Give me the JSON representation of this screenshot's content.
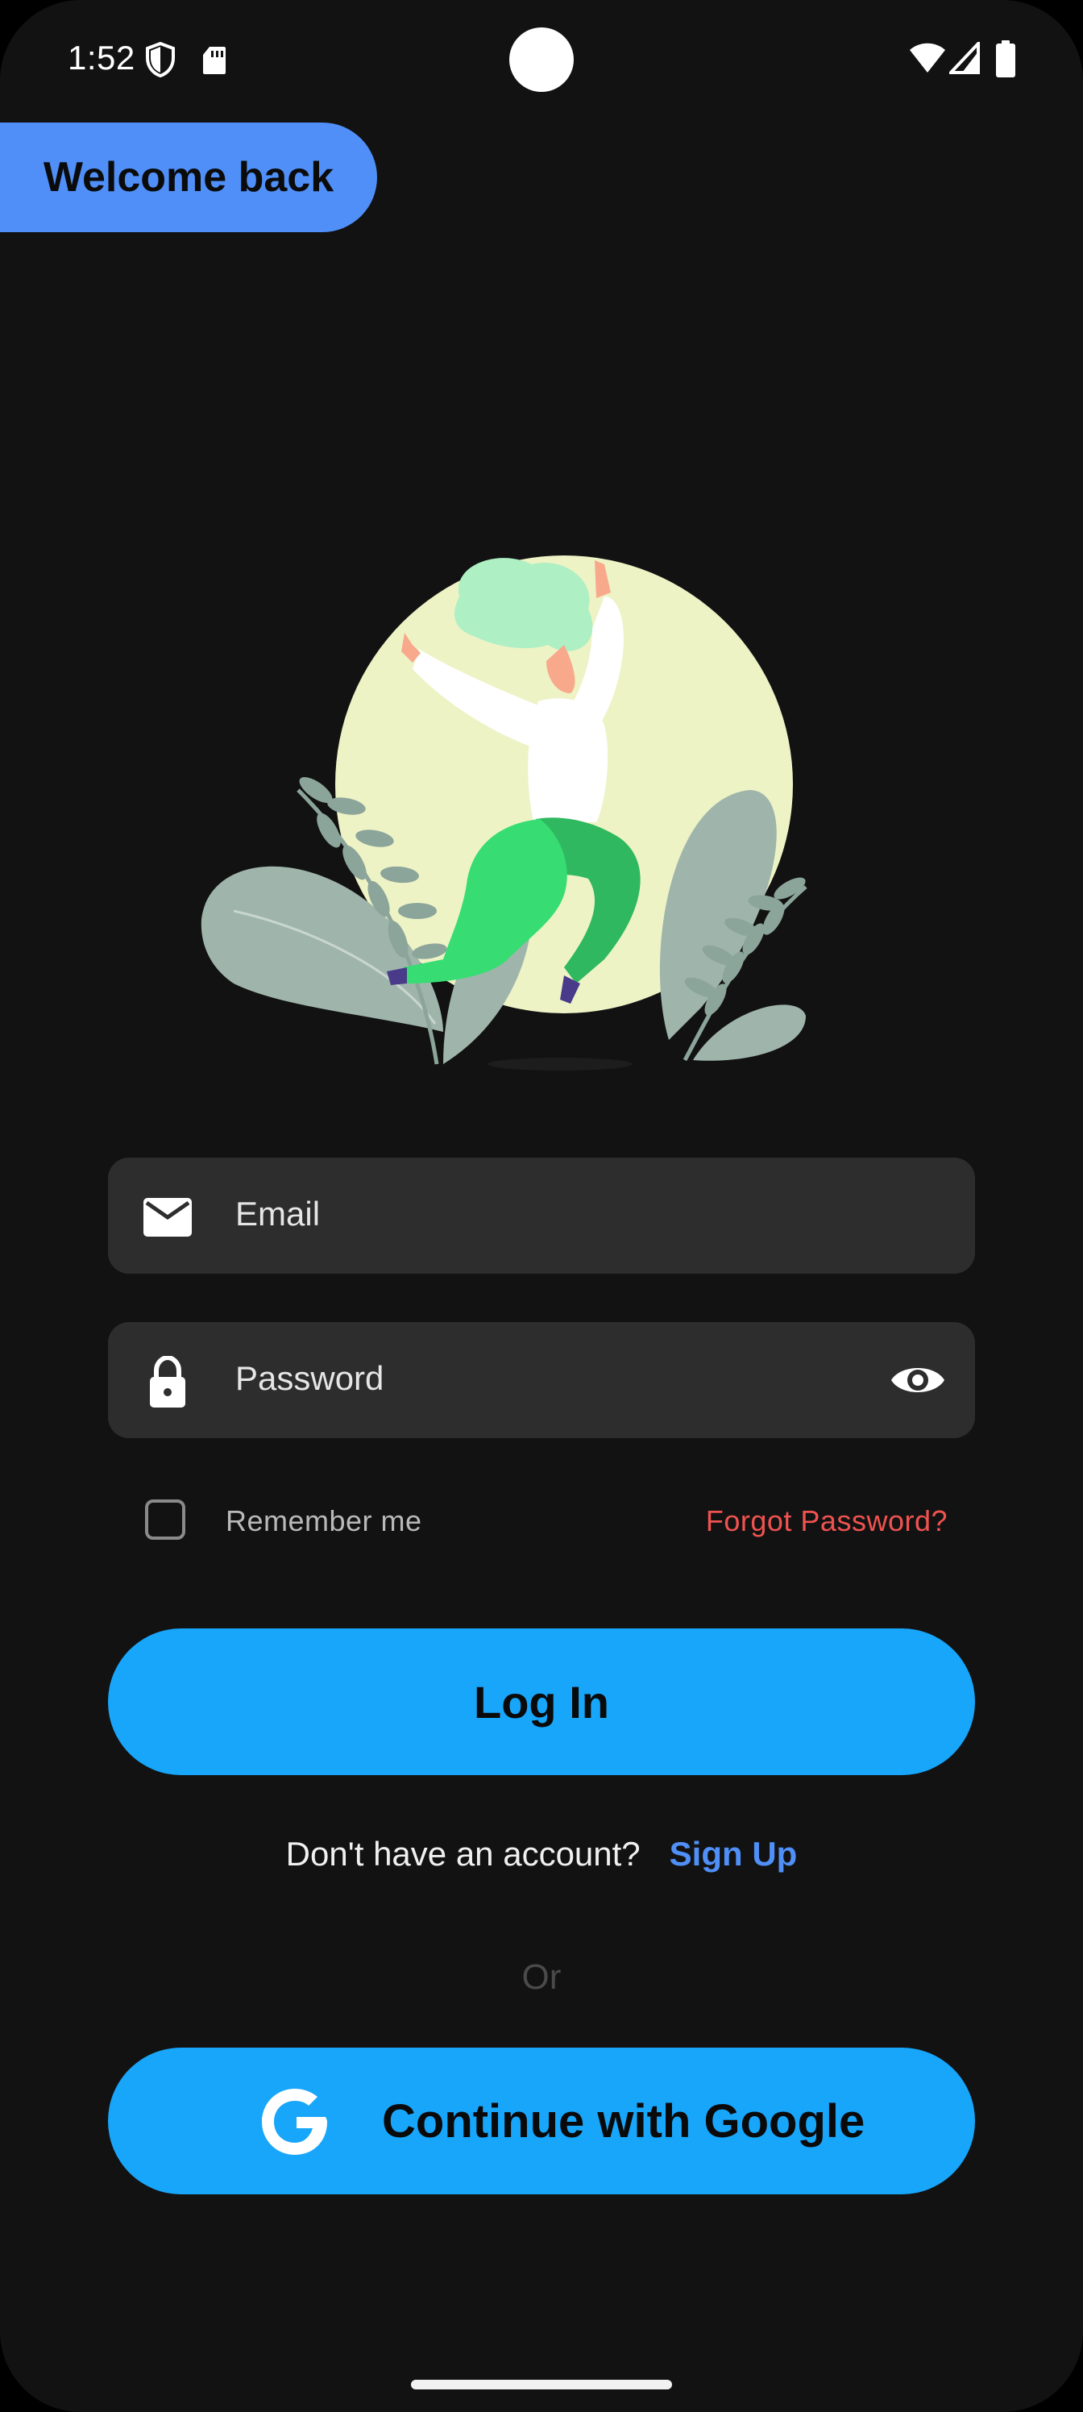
{
  "status_bar": {
    "time": "1:52",
    "icons_left": [
      "shield-icon",
      "sd-card-icon"
    ],
    "icons_right": [
      "wifi-icon",
      "signal-icon",
      "battery-icon"
    ]
  },
  "header": {
    "welcome": "Welcome back"
  },
  "form": {
    "email_placeholder": "Email",
    "password_placeholder": "Password",
    "remember_label": "Remember me",
    "remember_checked": false,
    "forgot_link": "Forgot Password?"
  },
  "actions": {
    "login_label": "Log In",
    "signup_prompt": "Don't have an account?",
    "signup_link": "Sign Up",
    "or_divider": "Or",
    "google_label": "Continue with Google"
  },
  "colors": {
    "background": "#121212",
    "accent_pill": "#4f8ff7",
    "primary_button": "#18a6fb",
    "input_background": "#2d2d2d",
    "forgot_link": "#ef5350",
    "signup_link": "#4f8ff7"
  }
}
